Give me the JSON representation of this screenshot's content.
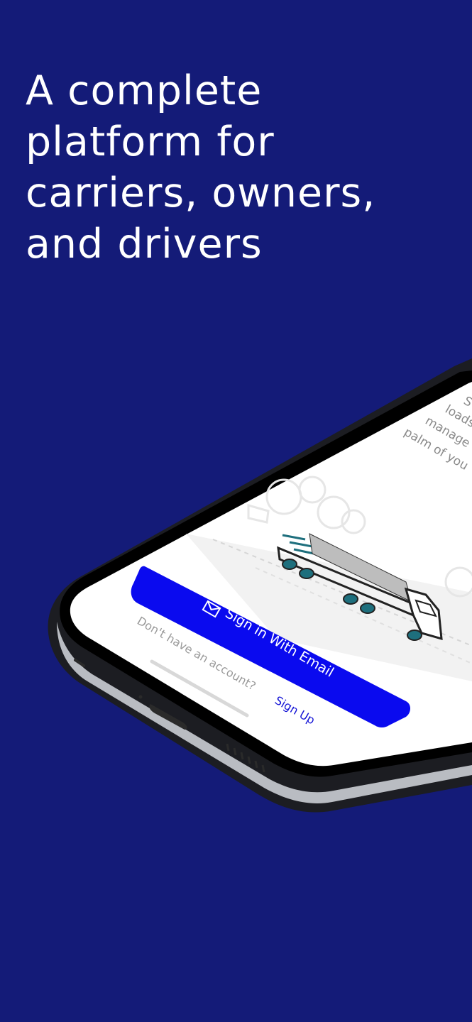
{
  "headline": {
    "lines": [
      "A complete",
      "platform for",
      "carriers, owners,",
      "and drivers"
    ]
  },
  "phone_screen": {
    "tagline_fragments": [
      "S",
      "loads",
      "manage",
      "palm of you"
    ],
    "sign_in_button_label": "Sign in With Email",
    "sign_in_icon": "envelope-icon",
    "no_account_text": "Don't have an account?",
    "sign_up_link": "Sign Up"
  },
  "colors": {
    "background": "#141b78",
    "button": "#0a0aef",
    "link": "#1515d6",
    "wheel": "#1e6f7d"
  }
}
